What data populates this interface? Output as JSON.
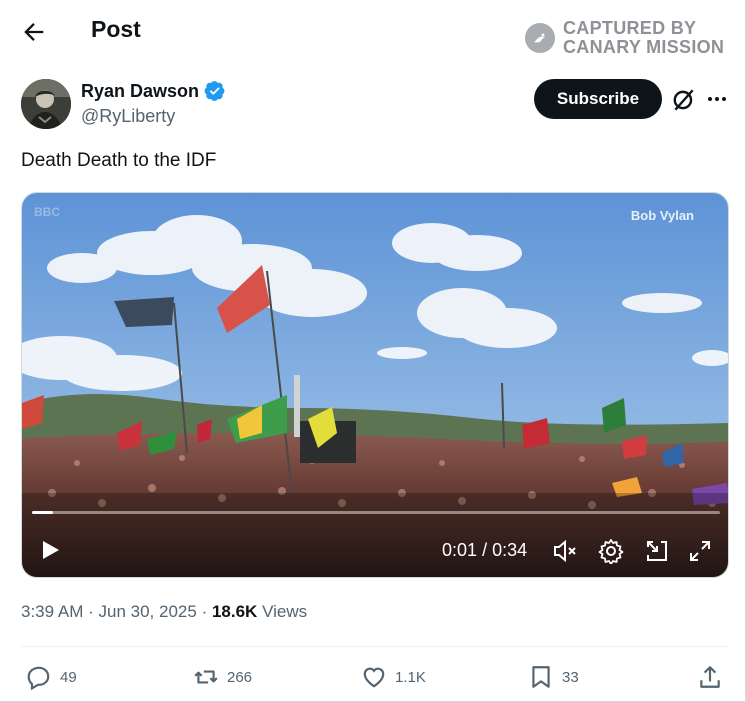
{
  "header": {
    "title": "Post"
  },
  "watermark": {
    "line1": "CAPTURED BY",
    "line2": "CANARY MISSION"
  },
  "author": {
    "name": "Ryan Dawson",
    "handle": "@RyLiberty",
    "verified": true,
    "verified_color": "#1d9bf0"
  },
  "actions_top": {
    "subscribe_label": "Subscribe"
  },
  "tweet": {
    "text": "Death Death to the IDF"
  },
  "video": {
    "overlay_label": "Bob Vylan",
    "broadcaster_label": "BBC",
    "current_time": "0:01",
    "separator": "/",
    "duration": "0:34",
    "progress_fraction": 0.03
  },
  "meta": {
    "time": "3:39 AM",
    "dot1": "·",
    "date": "Jun 30, 2025",
    "dot2": "·",
    "views_count": "18.6K",
    "views_label": "Views"
  },
  "engagement": {
    "replies": "49",
    "reposts": "266",
    "likes": "1.1K",
    "bookmarks": "33"
  },
  "icons": {
    "back": "arrow-left-icon",
    "verified": "verified-badge-icon",
    "grok": "grok-icon",
    "more": "more-icon",
    "play": "play-icon",
    "mute": "mute-icon",
    "settings": "gear-icon",
    "pip": "picture-in-picture-icon",
    "fullscreen": "fullscreen-icon",
    "reply": "reply-icon",
    "repost": "repost-icon",
    "like": "heart-icon",
    "bookmark": "bookmark-icon",
    "share": "share-icon"
  }
}
